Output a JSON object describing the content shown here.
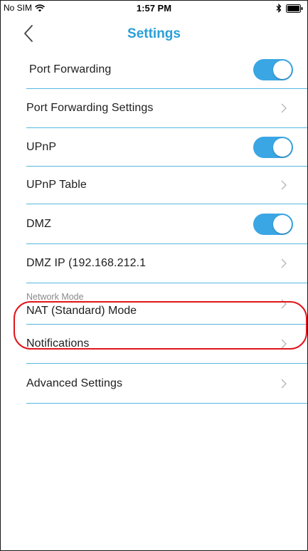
{
  "status_bar": {
    "carrier": "No SIM",
    "time": "1:57 PM",
    "icons": [
      "wifi-icon",
      "bluetooth-icon",
      "battery-icon"
    ]
  },
  "nav": {
    "title": "Settings",
    "back_icon": "chevron-left-icon"
  },
  "colors": {
    "accent": "#2a9fd8",
    "toggle_on": "#3aa6e4",
    "divider": "#56b8df",
    "highlight": "#e0151b"
  },
  "settings": {
    "port_forwarding": {
      "label": "Port Forwarding",
      "toggle_on": true
    },
    "port_forwarding_settings": {
      "label": "Port Forwarding Settings"
    },
    "upnp": {
      "label": "UPnP",
      "toggle_on": true
    },
    "upnp_table": {
      "label": "UPnP Table"
    },
    "dmz": {
      "label": "DMZ",
      "toggle_on": true
    },
    "dmz_ip": {
      "label": "DMZ IP (192.168.212.1"
    },
    "network_mode": {
      "label": "Network Mode",
      "value": "NAT (Standard) Mode"
    },
    "notifications": {
      "label": "Notifications"
    },
    "advanced_settings": {
      "label": "Advanced Settings"
    }
  }
}
